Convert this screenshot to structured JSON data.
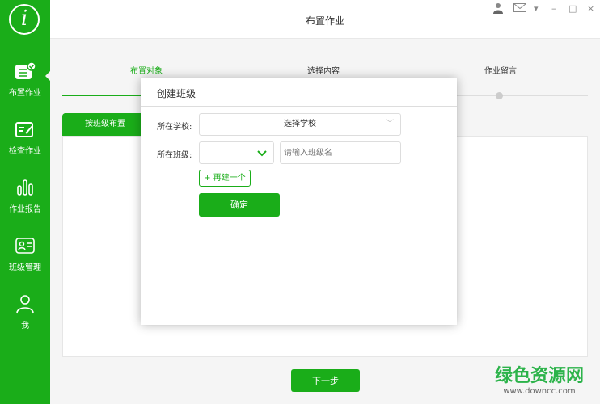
{
  "app": {
    "logo": "i",
    "title": "布置作业"
  },
  "sidebar": {
    "items": [
      {
        "label": "布置作业",
        "icon": "assign-icon"
      },
      {
        "label": "检查作业",
        "icon": "check-icon"
      },
      {
        "label": "作业报告",
        "icon": "report-icon"
      },
      {
        "label": "班级管理",
        "icon": "class-icon"
      },
      {
        "label": "我",
        "icon": "user-icon"
      }
    ]
  },
  "window": {
    "user": "user-icon",
    "mail": "mail-icon",
    "menu": "▾",
    "minimize": "–",
    "maximize": "□",
    "close": "×"
  },
  "steps": [
    "布置对象",
    "选择内容",
    "作业留言"
  ],
  "tab": "按班级布置",
  "next_label": "下一步",
  "modal": {
    "title": "创建班级",
    "school_label": "所在学校:",
    "school_value": "选择学校",
    "class_label": "所在班级:",
    "class_placeholder": "请输入班级名",
    "add_label": "+ 再建一个",
    "confirm_label": "确定"
  },
  "watermark": {
    "cn": "绿色资源网",
    "url": "www.downcc.com"
  },
  "colors": {
    "accent": "#1aad19"
  }
}
